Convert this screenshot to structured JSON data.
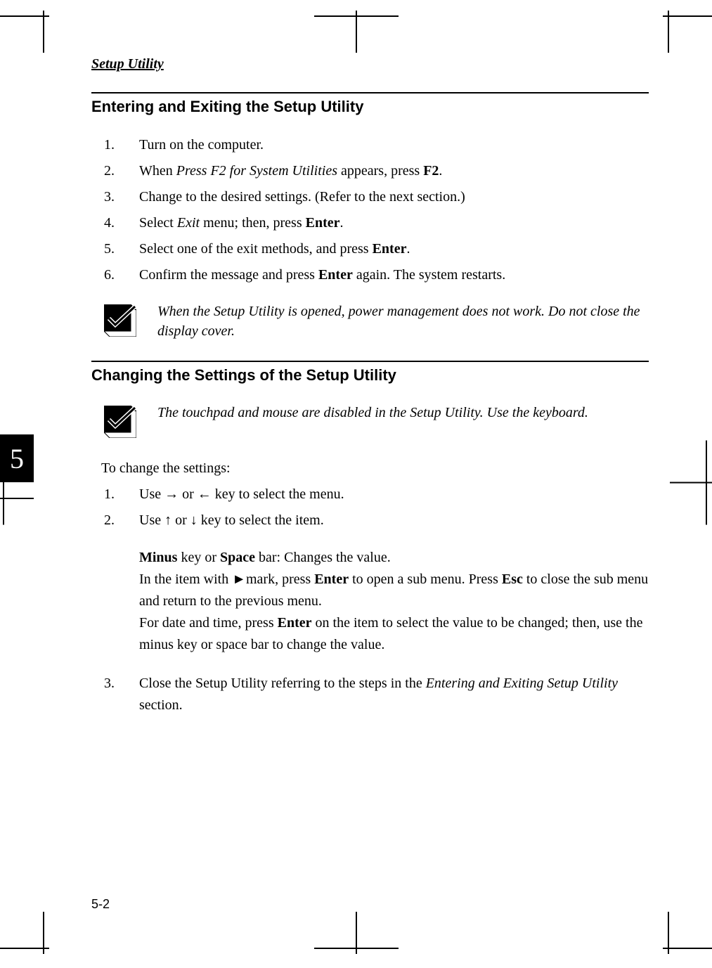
{
  "running_head": "Setup Utility",
  "section1": {
    "heading": "Entering and Exiting the Setup Utility",
    "steps": [
      {
        "n": "1.",
        "text": "Turn on the computer."
      },
      {
        "n": "2.",
        "pre": "When ",
        "em": "Press F2 for System Utilities",
        "mid": " appears, press ",
        "key": "F2",
        "post": "."
      },
      {
        "n": "3.",
        "text": "Change to the desired settings. (Refer to the next section.)"
      },
      {
        "n": "4.",
        "pre": "Select ",
        "em": "Exit",
        "mid": " menu; then, press ",
        "key": "Enter",
        "post": "."
      },
      {
        "n": "5.",
        "pre": "Select one of the exit methods, and press ",
        "key": "Enter",
        "post": "."
      },
      {
        "n": "6.",
        "pre": "Confirm the message and press ",
        "key": "Enter",
        "post": " again. The system restarts."
      }
    ],
    "note": "When the Setup Utility is opened, power management does not work. Do not close the display cover."
  },
  "section2": {
    "heading": "Changing the Settings of the Setup Utility",
    "note": "The touchpad and mouse are disabled in the Setup Utility. Use the keyboard.",
    "intro": "To change the settings:",
    "step1": {
      "n": "1.",
      "text": "Use → or ← key to select the menu."
    },
    "step2": {
      "n": "2.",
      "text": "Use ↑ or ↓ key to select the item."
    },
    "block": {
      "line1_key1": "Minus",
      "line1_mid": " key or ",
      "line1_key2": "Space",
      "line1_post": " bar: Changes the value.",
      "line2_pre": "In the item with ",
      "line2_tri": "►",
      "line2_mid": "mark, press ",
      "line2_key1": "Enter",
      "line2_mid2": " to open a sub menu. Press ",
      "line2_key2": "Esc",
      "line2_post": " to close the sub menu and return to the previous menu.",
      "line3_pre": "For date and time, press ",
      "line3_key": "Enter",
      "line3_post": " on the item to select the value to be changed; then, use the minus key or space bar to change the value."
    },
    "step3": {
      "n": "3.",
      "pre": "Close the Setup Utility referring to the steps in the ",
      "em": "Entering and Exiting Setup Utility",
      "post": " section."
    }
  },
  "tab": "5",
  "page_number": "5-2"
}
